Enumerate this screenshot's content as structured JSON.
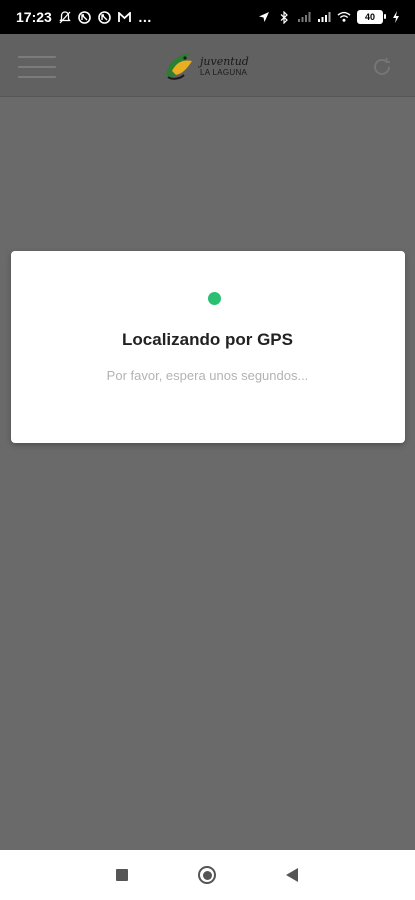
{
  "status_bar": {
    "time": "17:23",
    "battery": "40",
    "more_icon": "…"
  },
  "app_bar": {
    "logo_title": "juventud",
    "logo_subtitle": "LA LAGUNA"
  },
  "dialog": {
    "title": "Localizando por GPS",
    "message": "Por favor, espera unos segundos..."
  },
  "colors": {
    "overlay": "#6a6a6a",
    "accent_dot": "#2bbf72",
    "logo_green": "#2f7d32",
    "logo_yellow": "#e8b020"
  }
}
